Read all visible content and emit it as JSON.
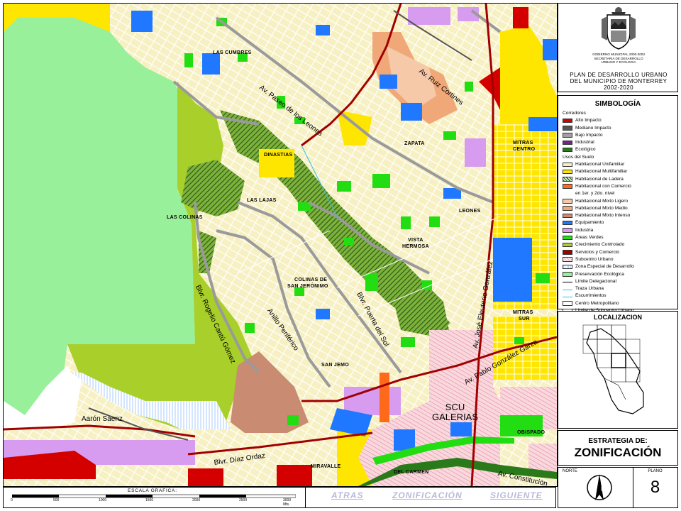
{
  "header": {
    "agency_line1": "GOBIERNO MUNICIPAL 2000-2003",
    "agency_line2": "SECRETARIA DE DESARROLLO",
    "agency_line3": "URBANO Y ECOLOGIA",
    "plan_line1": "PLAN DE DESARROLLO URBANO",
    "plan_line2": "DEL MUNICIPIO DE MONTERREY",
    "plan_years": "2002-2020"
  },
  "legend": {
    "title": "SIMBOLOGÍA",
    "corridors_header": "Corredores",
    "corridors": [
      {
        "label": "Alto Impacto",
        "color": "#d40000"
      },
      {
        "label": "Mediano Impacto",
        "color": "#555555"
      },
      {
        "label": "Bajo Impacto",
        "color": "#a0a0a0"
      },
      {
        "label": "Industrial",
        "color": "#7a1f8a"
      },
      {
        "label": "Ecológico",
        "color": "#2a7a1a"
      }
    ],
    "uses_header": "Usos del Suelo",
    "uses": [
      {
        "label": "Habitacional Unifamiliar",
        "color": "#f7f0c2"
      },
      {
        "label": "Habitacional Multifamiliar",
        "color": "#ffe600"
      },
      {
        "label": "Habitacional de Ladera",
        "color": "#3e7a2a",
        "pattern": "hatch"
      },
      {
        "label": "Habitacional con Comercio",
        "color": "#ff6a1a"
      },
      {
        "label": "en 1er. y 2do. nivel",
        "color": null
      },
      {
        "label": "Habitacional Mixto Ligero",
        "color": "#f6c9a8"
      },
      {
        "label": "Habitacional Mixto Medio",
        "color": "#f0a878"
      },
      {
        "label": "Habitacional Mixto Intenso",
        "color": "#c98b72"
      },
      {
        "label": "Equipamiento",
        "color": "#1f78ff"
      },
      {
        "label": "Industria",
        "color": "#d79cf0"
      },
      {
        "label": "Áreas Verdes",
        "color": "#22dd11"
      },
      {
        "label": "Crecimiento Controlado",
        "color": "#a8cf2a"
      },
      {
        "label": "Servicios y Comercio",
        "color": "#a00000"
      },
      {
        "label": "Subcentro Urbano",
        "color": "#f4b8c8",
        "pattern": "hatch"
      },
      {
        "label": "Zona Especial de Desarrollo",
        "color": "#ffffff",
        "pattern": "lines"
      },
      {
        "label": "Preservación Ecológica",
        "color": "#99f09a"
      },
      {
        "label": "Límite Delegacional",
        "color": null,
        "line": "#000000"
      },
      {
        "label": "Traza Urbana",
        "color": null,
        "line": "#33bbee"
      },
      {
        "label": "Escurrimientos",
        "color": null,
        "line": "#33bbee"
      },
      {
        "label": "Centro Metropolitano",
        "color": "#ffffff"
      },
      {
        "label": "Límite de Subcentro Urbano",
        "color": "#ffffff"
      }
    ]
  },
  "localizacion": {
    "title": "LOCALIZACION"
  },
  "strategy": {
    "line1": "ESTRATEGIA DE:",
    "line2": "ZONIFICACIÓN"
  },
  "footer": {
    "norte": "NORTE",
    "plano_label": "PLANO",
    "plano_number": "8"
  },
  "scale": {
    "title": "ESCALA GRAFICA:",
    "ticks": [
      "0",
      "500",
      "1000",
      "1500",
      "2000",
      "2500",
      "3000 Mts."
    ]
  },
  "nav": {
    "back": "ATRAS",
    "current": "ZONIFICACIÓN",
    "next": "SIGUIENTE"
  },
  "map": {
    "places": [
      "LAS CUMBRES",
      "ZAPATA",
      "DINASTIAS",
      "LAS LAJAS",
      "LAS COLINAS",
      "LEONES",
      "VISTA",
      "HERMOSA",
      "COLINAS DE",
      "SAN JERÓNIMO",
      "SAN JEMO",
      "MITRAS",
      "CENTRO",
      "MITRAS",
      "SUR",
      "OBISPADO",
      "MIRAVALLE",
      "DEL CARMEN"
    ],
    "roads": [
      "Av. Paseo de los Leones",
      "Av. Ruiz Cortines",
      "Blvr. Rogelio Cantú Gómez",
      "Anillo Periférico",
      "Blvr. Puerta del Sol",
      "Av. José Eleuterio González",
      "Av. Pablo González Garza",
      "Aarón Saenz",
      "Blvr. Díaz Ordaz",
      "Av. Constitución"
    ],
    "district": [
      "SCU",
      "GALERIAS"
    ]
  }
}
